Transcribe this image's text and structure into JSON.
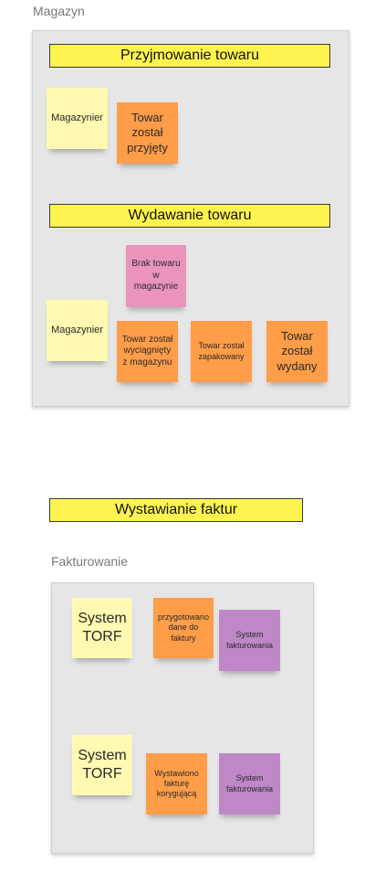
{
  "frames": {
    "magazyn": {
      "label": "Magazyn"
    },
    "fakturowanie": {
      "label": "Fakturowanie"
    }
  },
  "banners": {
    "przyjmowanie": "Przyjmowanie towaru",
    "wydawanie": "Wydawanie towaru",
    "wystawianie": "Wystawianie faktur"
  },
  "stickies": {
    "magazynier_1": "Magazynier",
    "towar_przyjety": "Towar został przyjęty",
    "brak_towaru": "Brak towaru w magazynie",
    "magazynier_2": "Magazynier",
    "towar_wyciagniety": "Towar został wyciągnięty z magazynu",
    "towar_zapakowany": "Towar został zapakowany",
    "towar_wydany": "Towar został wydany",
    "system_torf_1": "System TORF",
    "przygotowano_dane": "przygotowano dane do faktury",
    "system_fakturowania_1": "System fakturowania",
    "system_torf_2": "System TORF",
    "wystawiono_fakture": "Wystawiono fakturę korygującą",
    "system_fakturowania_2": "System fakturowania"
  },
  "colors": {
    "yellow_sticky": "#fff9b1",
    "orange_sticky": "#ff9d48",
    "pink_sticky": "#ea94bb",
    "purple_sticky": "#be88c7",
    "banner": "#fff44f",
    "frame_background": "#e6e6e6"
  }
}
